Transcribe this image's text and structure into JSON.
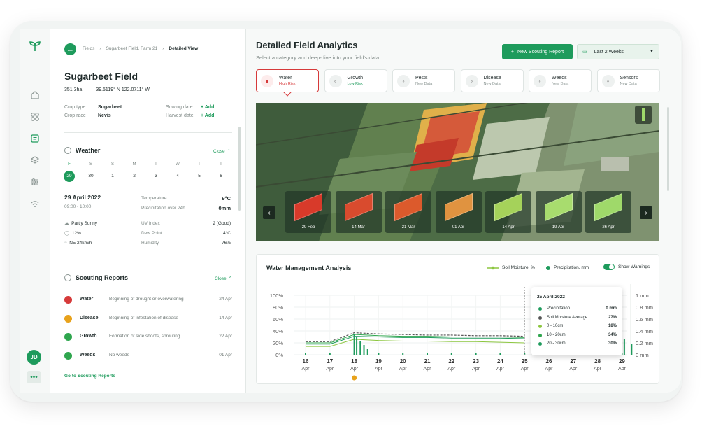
{
  "breadcrumb": {
    "items": [
      "Fields",
      "Sugarbeet Field, Farm 21",
      "Detailed View"
    ]
  },
  "field": {
    "name": "Sugarbeet Field",
    "area": "351.3ha",
    "coords": "39.5119° N 122.0711° W",
    "crop_type_label": "Crop type",
    "crop_type": "Sugarbeet",
    "crop_race_label": "Crop race",
    "crop_race": "Nevis",
    "sowing_label": "Sowing date",
    "sowing_add": "+ Add",
    "harvest_label": "Harvest date",
    "harvest_add": "+ Add"
  },
  "weather": {
    "title": "Weather",
    "close": "Close",
    "weekdays": [
      "F",
      "S",
      "S",
      "M",
      "T",
      "W",
      "T",
      "T"
    ],
    "days": [
      "29",
      "30",
      "1",
      "2",
      "3",
      "4",
      "5",
      "6"
    ],
    "date": "29 April 2022",
    "time": "09:00 - 10:00",
    "rows": [
      {
        "label": "Temperature",
        "value": "9°C"
      },
      {
        "label": "Precipitation over 24h",
        "value": "0mm"
      }
    ],
    "cond": "Partly Sunny",
    "humidity_pct": "12%",
    "wind": "NE 24km/h",
    "rows2": [
      {
        "label": "UV Index",
        "value": "2 (Good)"
      },
      {
        "label": "Dew Point",
        "value": "4°C"
      },
      {
        "label": "Humidity",
        "value": "76%"
      }
    ]
  },
  "scouting": {
    "title": "Scouting Reports",
    "close": "Close",
    "items": [
      {
        "name": "Water",
        "desc": "Beginning of drought or overwatering",
        "date": "24 Apr",
        "color": "#d63a3a"
      },
      {
        "name": "Disease",
        "desc": "Beginning of infestation of disease",
        "date": "14 Apr",
        "color": "#e8a21b"
      },
      {
        "name": "Growth",
        "desc": "Formation of side shoots, sprouting",
        "date": "22 Apr",
        "color": "#2fa64e"
      },
      {
        "name": "Weeds",
        "desc": "No weeds",
        "date": "01 Apr",
        "color": "#2fa64e"
      }
    ],
    "link": "Go to Scouting Reports"
  },
  "user": {
    "initials": "JD"
  },
  "main": {
    "title": "Detailed Field Analytics",
    "subtitle": "Select a category and deep-dive into your field's data",
    "new_report": "New Scouting Report",
    "range": "Last 2 Weeks"
  },
  "categories": [
    {
      "name": "Water",
      "status": "High Risk",
      "status_color": "#d63a3a"
    },
    {
      "name": "Growth",
      "status": "Low Risk",
      "status_color": "#1e9b5c"
    },
    {
      "name": "Pests",
      "status": "New Data",
      "status_color": "#8a9592"
    },
    {
      "name": "Disease",
      "status": "New Data",
      "status_color": "#8a9592"
    },
    {
      "name": "Weeds",
      "status": "New Data",
      "status_color": "#8a9592"
    },
    {
      "name": "Sensors",
      "status": "New Data",
      "status_color": "#8a9592"
    }
  ],
  "thumbnails": [
    {
      "date": "29 Feb",
      "color": "#d83a2a"
    },
    {
      "date": "14 Mar",
      "color": "#d94b2e"
    },
    {
      "date": "21 Mar",
      "color": "#dc5a2c"
    },
    {
      "date": "01 Apr",
      "color": "#e09340"
    },
    {
      "date": "14 Apr",
      "color": "#a5d25a"
    },
    {
      "date": "19 Apr",
      "color": "#a8dc6e"
    },
    {
      "date": "26 Apr",
      "color": "#9fd96a"
    }
  ],
  "analysis": {
    "title": "Water Management Analysis",
    "legend_moisture": "Soil Moisture, %",
    "legend_precip": "Precipitation, mm",
    "warnings": "Show Warnings"
  },
  "chart_data": {
    "type": "line",
    "x": [
      "16",
      "17",
      "18",
      "19",
      "20",
      "21",
      "22",
      "23",
      "24",
      "25",
      "26",
      "27",
      "28",
      "29"
    ],
    "x_sub": "Apr",
    "y_ticks": [
      "100%",
      "80%",
      "60%",
      "40%",
      "20%",
      "0%"
    ],
    "y2_ticks": [
      "1 mm",
      "0.8 mm",
      "0.6 mm",
      "0.4 mm",
      "0.2 mm",
      "0 mm"
    ],
    "ylim": [
      0,
      100
    ],
    "series": [
      {
        "name": "Soil Moisture Average",
        "values": [
          22,
          22,
          37,
          35,
          34,
          33,
          33,
          32,
          32,
          31
        ]
      },
      {
        "name": "0 - 10cm",
        "values": [
          14,
          14,
          26,
          24,
          23,
          23,
          22,
          22,
          21,
          20
        ]
      },
      {
        "name": "10 - 20cm",
        "values": [
          20,
          20,
          34,
          32,
          31,
          31,
          30,
          30,
          30,
          29
        ]
      },
      {
        "name": "20 - 30cm",
        "values": [
          18,
          18,
          31,
          30,
          29,
          29,
          28,
          28,
          28,
          27
        ]
      }
    ],
    "tooltip": {
      "date": "25 April 2022",
      "rows": [
        {
          "label": "Precipitation",
          "value": "0 mm"
        },
        {
          "label": "Soil Moisture Average",
          "value": "27%"
        },
        {
          "label": "0 - 10cm",
          "value": "18%"
        },
        {
          "label": "10 - 20cm",
          "value": "34%"
        },
        {
          "label": "20 - 30cm",
          "value": "30%"
        }
      ]
    }
  }
}
